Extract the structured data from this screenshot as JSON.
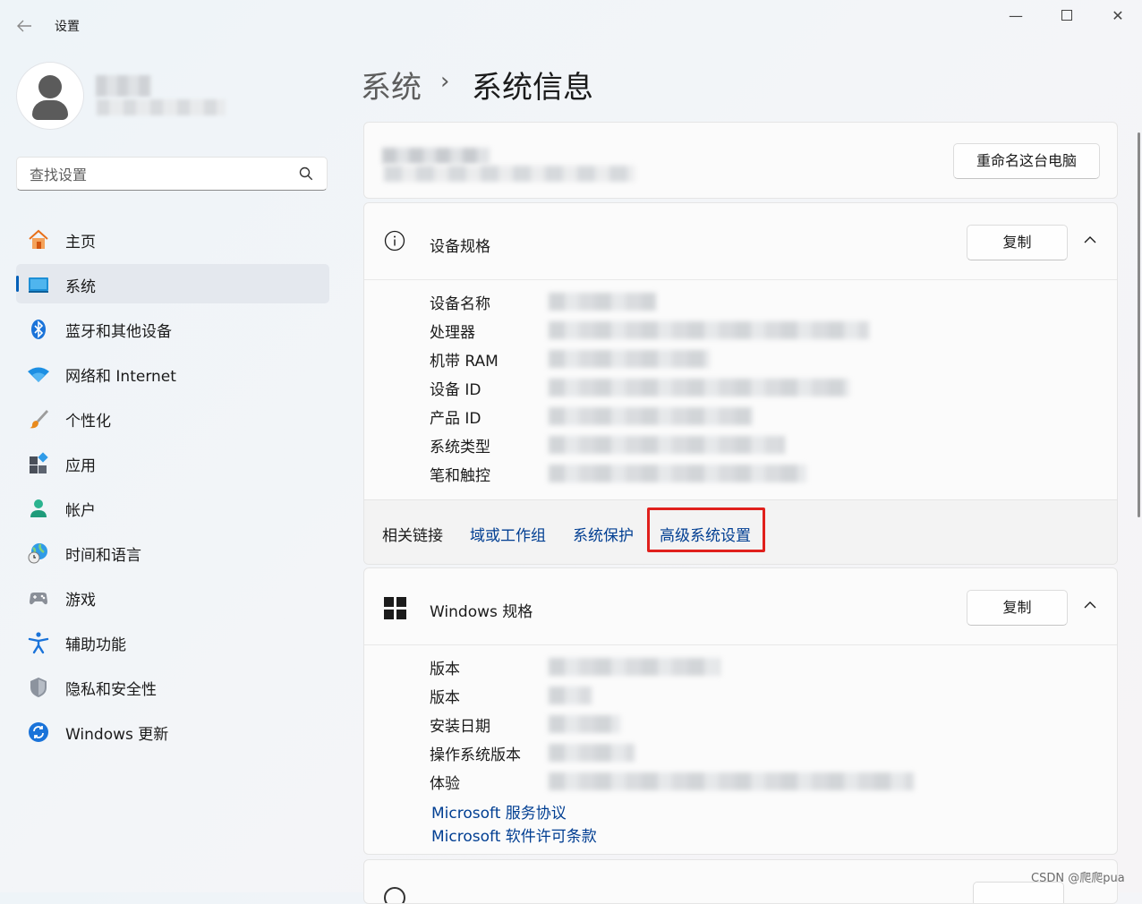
{
  "window": {
    "title": "设置",
    "back_icon": "arrow-left-icon",
    "controls": [
      "minimize-icon",
      "maximize-icon",
      "close-icon"
    ]
  },
  "search": {
    "placeholder": "查找设置",
    "value": ""
  },
  "sidebar": {
    "items": [
      {
        "label": "主页",
        "icon": "home-icon",
        "active": false
      },
      {
        "label": "系统",
        "icon": "system-display-icon",
        "active": true
      },
      {
        "label": "蓝牙和其他设备",
        "icon": "bluetooth-icon",
        "active": false
      },
      {
        "label": "网络和 Internet",
        "icon": "wifi-icon",
        "active": false
      },
      {
        "label": "个性化",
        "icon": "paintbrush-icon",
        "active": false
      },
      {
        "label": "应用",
        "icon": "apps-icon",
        "active": false
      },
      {
        "label": "帐户",
        "icon": "account-icon",
        "active": false
      },
      {
        "label": "时间和语言",
        "icon": "globe-clock-icon",
        "active": false
      },
      {
        "label": "游戏",
        "icon": "gamepad-icon",
        "active": false
      },
      {
        "label": "辅助功能",
        "icon": "accessibility-icon",
        "active": false
      },
      {
        "label": "隐私和安全性",
        "icon": "shield-icon",
        "active": false
      },
      {
        "label": "Windows 更新",
        "icon": "update-sync-icon",
        "active": false
      }
    ]
  },
  "breadcrumb": {
    "parent": "系统",
    "separator": "›",
    "current": "系统信息"
  },
  "pc_card": {
    "rename_label": "重命名这台电脑"
  },
  "device_specs": {
    "title": "设备规格",
    "copy_label": "复制",
    "rows": [
      {
        "key": "设备名称"
      },
      {
        "key": "处理器"
      },
      {
        "key": "机带 RAM"
      },
      {
        "key": "设备 ID"
      },
      {
        "key": "产品 ID"
      },
      {
        "key": "系统类型"
      },
      {
        "key": "笔和触控"
      }
    ],
    "related_label": "相关链接",
    "links": [
      "域或工作组",
      "系统保护",
      "高级系统设置"
    ]
  },
  "windows_specs": {
    "title": "Windows 规格",
    "copy_label": "复制",
    "rows": [
      {
        "key": "版本"
      },
      {
        "key": "版本"
      },
      {
        "key": "安装日期"
      },
      {
        "key": "操作系统版本"
      },
      {
        "key": "体验"
      }
    ],
    "links": [
      "Microsoft 服务协议",
      "Microsoft 软件许可条款"
    ]
  },
  "watermark": "CSDN @爬爬pua",
  "colors": {
    "accent": "#005fb8",
    "link": "#003e92",
    "highlight_box": "#e0201c"
  }
}
